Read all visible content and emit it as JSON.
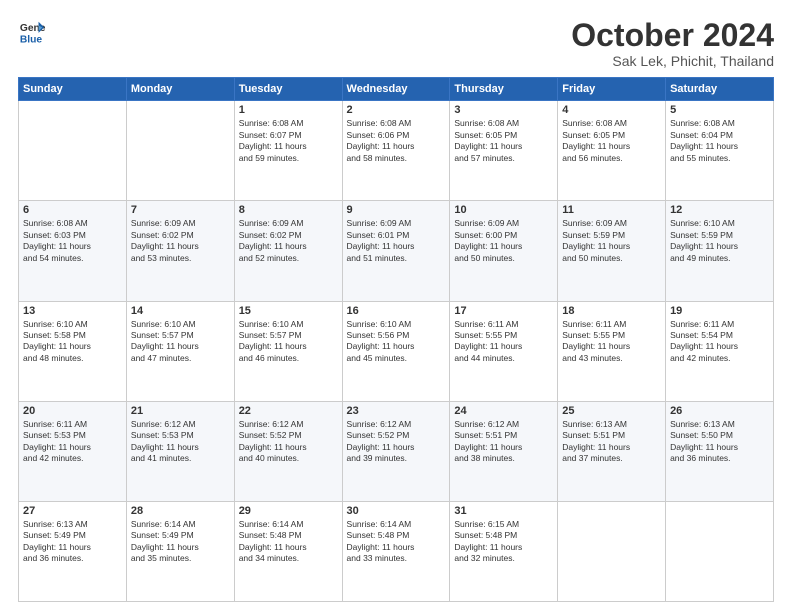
{
  "header": {
    "logo_line1": "General",
    "logo_line2": "Blue",
    "month": "October 2024",
    "location": "Sak Lek, Phichit, Thailand"
  },
  "days": [
    "Sunday",
    "Monday",
    "Tuesday",
    "Wednesday",
    "Thursday",
    "Friday",
    "Saturday"
  ],
  "weeks": [
    [
      {
        "num": "",
        "info": ""
      },
      {
        "num": "",
        "info": ""
      },
      {
        "num": "1",
        "info": "Sunrise: 6:08 AM\nSunset: 6:07 PM\nDaylight: 11 hours\nand 59 minutes."
      },
      {
        "num": "2",
        "info": "Sunrise: 6:08 AM\nSunset: 6:06 PM\nDaylight: 11 hours\nand 58 minutes."
      },
      {
        "num": "3",
        "info": "Sunrise: 6:08 AM\nSunset: 6:05 PM\nDaylight: 11 hours\nand 57 minutes."
      },
      {
        "num": "4",
        "info": "Sunrise: 6:08 AM\nSunset: 6:05 PM\nDaylight: 11 hours\nand 56 minutes."
      },
      {
        "num": "5",
        "info": "Sunrise: 6:08 AM\nSunset: 6:04 PM\nDaylight: 11 hours\nand 55 minutes."
      }
    ],
    [
      {
        "num": "6",
        "info": "Sunrise: 6:08 AM\nSunset: 6:03 PM\nDaylight: 11 hours\nand 54 minutes."
      },
      {
        "num": "7",
        "info": "Sunrise: 6:09 AM\nSunset: 6:02 PM\nDaylight: 11 hours\nand 53 minutes."
      },
      {
        "num": "8",
        "info": "Sunrise: 6:09 AM\nSunset: 6:02 PM\nDaylight: 11 hours\nand 52 minutes."
      },
      {
        "num": "9",
        "info": "Sunrise: 6:09 AM\nSunset: 6:01 PM\nDaylight: 11 hours\nand 51 minutes."
      },
      {
        "num": "10",
        "info": "Sunrise: 6:09 AM\nSunset: 6:00 PM\nDaylight: 11 hours\nand 50 minutes."
      },
      {
        "num": "11",
        "info": "Sunrise: 6:09 AM\nSunset: 5:59 PM\nDaylight: 11 hours\nand 50 minutes."
      },
      {
        "num": "12",
        "info": "Sunrise: 6:10 AM\nSunset: 5:59 PM\nDaylight: 11 hours\nand 49 minutes."
      }
    ],
    [
      {
        "num": "13",
        "info": "Sunrise: 6:10 AM\nSunset: 5:58 PM\nDaylight: 11 hours\nand 48 minutes."
      },
      {
        "num": "14",
        "info": "Sunrise: 6:10 AM\nSunset: 5:57 PM\nDaylight: 11 hours\nand 47 minutes."
      },
      {
        "num": "15",
        "info": "Sunrise: 6:10 AM\nSunset: 5:57 PM\nDaylight: 11 hours\nand 46 minutes."
      },
      {
        "num": "16",
        "info": "Sunrise: 6:10 AM\nSunset: 5:56 PM\nDaylight: 11 hours\nand 45 minutes."
      },
      {
        "num": "17",
        "info": "Sunrise: 6:11 AM\nSunset: 5:55 PM\nDaylight: 11 hours\nand 44 minutes."
      },
      {
        "num": "18",
        "info": "Sunrise: 6:11 AM\nSunset: 5:55 PM\nDaylight: 11 hours\nand 43 minutes."
      },
      {
        "num": "19",
        "info": "Sunrise: 6:11 AM\nSunset: 5:54 PM\nDaylight: 11 hours\nand 42 minutes."
      }
    ],
    [
      {
        "num": "20",
        "info": "Sunrise: 6:11 AM\nSunset: 5:53 PM\nDaylight: 11 hours\nand 42 minutes."
      },
      {
        "num": "21",
        "info": "Sunrise: 6:12 AM\nSunset: 5:53 PM\nDaylight: 11 hours\nand 41 minutes."
      },
      {
        "num": "22",
        "info": "Sunrise: 6:12 AM\nSunset: 5:52 PM\nDaylight: 11 hours\nand 40 minutes."
      },
      {
        "num": "23",
        "info": "Sunrise: 6:12 AM\nSunset: 5:52 PM\nDaylight: 11 hours\nand 39 minutes."
      },
      {
        "num": "24",
        "info": "Sunrise: 6:12 AM\nSunset: 5:51 PM\nDaylight: 11 hours\nand 38 minutes."
      },
      {
        "num": "25",
        "info": "Sunrise: 6:13 AM\nSunset: 5:51 PM\nDaylight: 11 hours\nand 37 minutes."
      },
      {
        "num": "26",
        "info": "Sunrise: 6:13 AM\nSunset: 5:50 PM\nDaylight: 11 hours\nand 36 minutes."
      }
    ],
    [
      {
        "num": "27",
        "info": "Sunrise: 6:13 AM\nSunset: 5:49 PM\nDaylight: 11 hours\nand 36 minutes."
      },
      {
        "num": "28",
        "info": "Sunrise: 6:14 AM\nSunset: 5:49 PM\nDaylight: 11 hours\nand 35 minutes."
      },
      {
        "num": "29",
        "info": "Sunrise: 6:14 AM\nSunset: 5:48 PM\nDaylight: 11 hours\nand 34 minutes."
      },
      {
        "num": "30",
        "info": "Sunrise: 6:14 AM\nSunset: 5:48 PM\nDaylight: 11 hours\nand 33 minutes."
      },
      {
        "num": "31",
        "info": "Sunrise: 6:15 AM\nSunset: 5:48 PM\nDaylight: 11 hours\nand 32 minutes."
      },
      {
        "num": "",
        "info": ""
      },
      {
        "num": "",
        "info": ""
      }
    ]
  ]
}
